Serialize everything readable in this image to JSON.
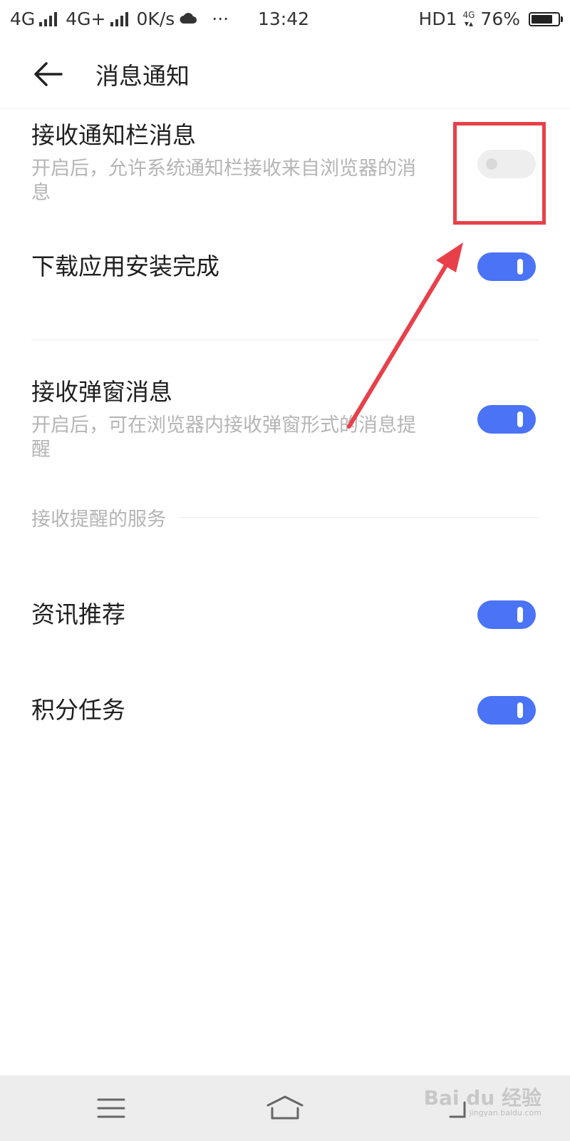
{
  "status_bar": {
    "network1": "4G",
    "network2": "4G+",
    "speed": "0K/s",
    "more": "···",
    "time": "13:42",
    "hd": "HD1",
    "small_4g": "4G",
    "battery": "76%"
  },
  "header": {
    "title": "消息通知"
  },
  "settings": [
    {
      "title": "接收通知栏消息",
      "description": "开启后，允许系统通知栏接收来自浏览器的消息",
      "enabled": false
    },
    {
      "title": "下载应用安装完成",
      "description": "",
      "enabled": true
    },
    {
      "title": "接收弹窗消息",
      "description": "开启后，可在浏览器内接收弹窗形式的消息提醒",
      "enabled": true
    }
  ],
  "section": {
    "title": "接收提醒的服务",
    "items": [
      {
        "title": "资讯推荐",
        "enabled": true
      },
      {
        "title": "积分任务",
        "enabled": true
      }
    ]
  },
  "watermark": {
    "brand": "Bai du 经验",
    "url": "jingyan.baidu.com"
  },
  "colors": {
    "toggle_on": "#4a73f5",
    "toggle_off": "#eeeeee",
    "annotation": "#e8404a"
  }
}
